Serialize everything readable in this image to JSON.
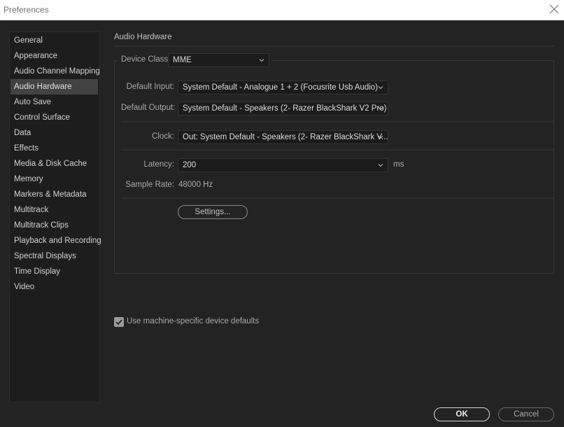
{
  "window": {
    "title": "Preferences",
    "close_icon": "close-icon"
  },
  "sidebar": {
    "items": [
      {
        "label": "General",
        "active": false
      },
      {
        "label": "Appearance",
        "active": false
      },
      {
        "label": "Audio Channel Mapping",
        "active": false
      },
      {
        "label": "Audio Hardware",
        "active": true
      },
      {
        "label": "Auto Save",
        "active": false
      },
      {
        "label": "Control Surface",
        "active": false
      },
      {
        "label": "Data",
        "active": false
      },
      {
        "label": "Effects",
        "active": false
      },
      {
        "label": "Media & Disk Cache",
        "active": false
      },
      {
        "label": "Memory",
        "active": false
      },
      {
        "label": "Markers & Metadata",
        "active": false
      },
      {
        "label": "Multitrack",
        "active": false
      },
      {
        "label": "Multitrack Clips",
        "active": false
      },
      {
        "label": "Playback and Recording",
        "active": false
      },
      {
        "label": "Spectral Displays",
        "active": false
      },
      {
        "label": "Time Display",
        "active": false
      },
      {
        "label": "Video",
        "active": false
      }
    ]
  },
  "panel": {
    "title": "Audio Hardware",
    "device_class": {
      "label": "Device Class:",
      "value": "MME"
    },
    "default_input": {
      "label": "Default Input:",
      "value": "System Default - Analogue 1 + 2 (Focusrite Usb Audio)"
    },
    "default_output": {
      "label": "Default Output:",
      "value": "System Default - Speakers (2- Razer BlackShark V2 Pro)"
    },
    "clock": {
      "label": "Clock:",
      "value": "Out: System Default - Speakers (2- Razer BlackShark V..."
    },
    "latency": {
      "label": "Latency:",
      "value": "200",
      "unit": "ms"
    },
    "sample_rate": {
      "label": "Sample Rate:",
      "value": "48000 Hz"
    },
    "settings_button": "Settings..."
  },
  "machine_defaults": {
    "label": "Use machine-specific device defaults",
    "checked": true
  },
  "footer": {
    "ok": "OK",
    "cancel": "Cancel"
  }
}
